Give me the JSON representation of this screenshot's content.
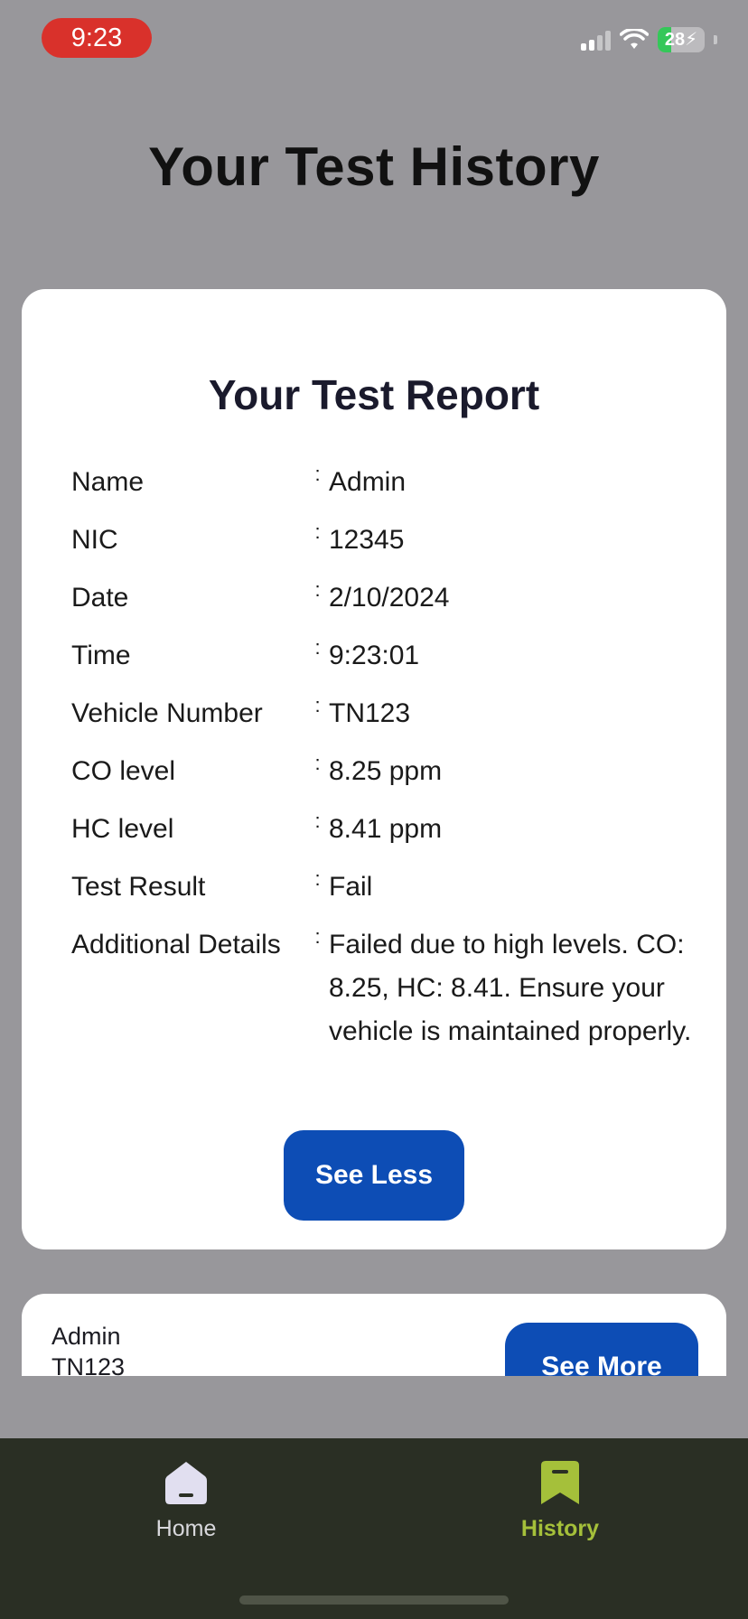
{
  "status_bar": {
    "time": "9:23",
    "battery": "28",
    "battery_level_percent": 28,
    "icons": [
      "signal-icon",
      "wifi-icon",
      "battery-charging-icon"
    ]
  },
  "page": {
    "title": "Your Test History"
  },
  "report": {
    "title": "Your Test Report",
    "rows": [
      {
        "label": "Name",
        "value": "Admin"
      },
      {
        "label": "NIC",
        "value": "12345"
      },
      {
        "label": "Date",
        "value": "2/10/2024"
      },
      {
        "label": "Time",
        "value": "9:23:01"
      },
      {
        "label": "Vehicle Number",
        "value": "TN123"
      },
      {
        "label": "CO level",
        "value": "8.25 ppm"
      },
      {
        "label": "HC level",
        "value": "8.41 ppm"
      },
      {
        "label": "Test Result",
        "value": "Fail"
      },
      {
        "label": "Additional Details",
        "value": "Failed due to high levels. CO: 8.25, HC: 8.41. Ensure your vehicle is maintained properly."
      }
    ],
    "separator": ":",
    "see_less_label": "See Less"
  },
  "next_card": {
    "name": "Admin",
    "vehicle": "TN123",
    "see_more_label": "See More"
  },
  "tabbar": {
    "tabs": [
      {
        "label": "Home",
        "icon": "home-icon",
        "active": false
      },
      {
        "label": "History",
        "icon": "bookmark-icon",
        "active": true
      }
    ],
    "colors": {
      "active": "#a5c03a",
      "inactive": "#d8d8dc",
      "background": "#2a2f24"
    }
  },
  "colors": {
    "button": "#0d4db5",
    "page_background": "#98979b",
    "status_time_pill": "#d9312b"
  }
}
